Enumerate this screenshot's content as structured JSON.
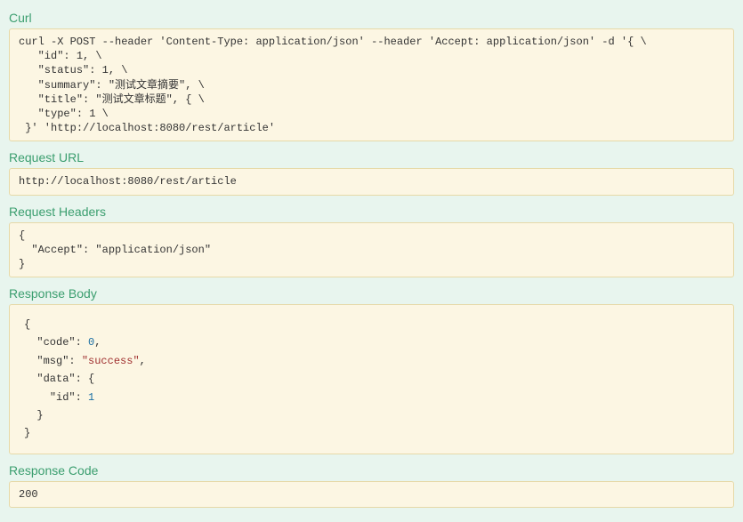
{
  "labels": {
    "curl": "Curl",
    "requestUrl": "Request URL",
    "requestHeaders": "Request Headers",
    "responseBody": "Response Body",
    "responseCode": "Response Code"
  },
  "curlCommand": "curl -X POST --header 'Content-Type: application/json' --header 'Accept: application/json' -d '{ \\\n   \"id\": 1, \\\n   \"status\": 1, \\\n   \"summary\": \"测试文章摘要\", \\\n   \"title\": \"测试文章标题\", { \\\n   \"type\": 1 \\\n }' 'http://localhost:8080/rest/article'",
  "requestUrl": "http://localhost:8080/rest/article",
  "requestHeaders": "{\n  \"Accept\": \"application/json\"\n}",
  "responseBodyTokens": [
    {
      "t": "{\n  \"code\": "
    },
    {
      "t": "0",
      "c": "num"
    },
    {
      "t": ",\n  \"msg\": "
    },
    {
      "t": "\"success\"",
      "c": "str"
    },
    {
      "t": ",\n  \"data\": {\n    \"id\": "
    },
    {
      "t": "1",
      "c": "num"
    },
    {
      "t": "\n  }\n}"
    }
  ],
  "responseCode": "200"
}
